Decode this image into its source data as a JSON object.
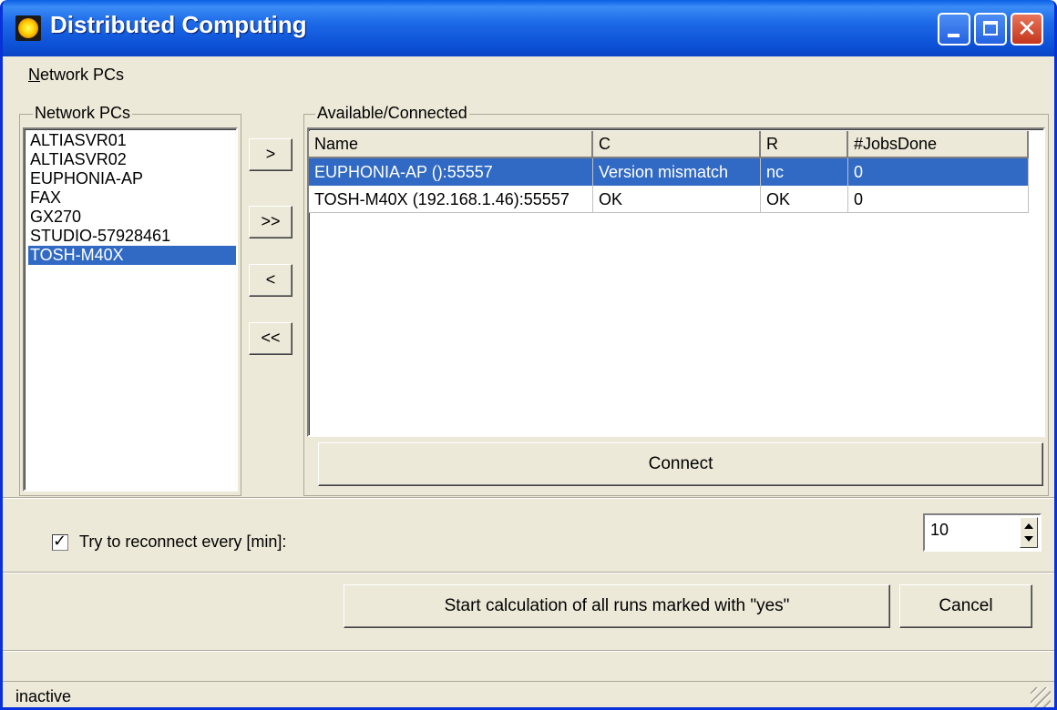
{
  "window": {
    "title": "Distributed Computing",
    "colors": {
      "titlebar": "#0a5fe6",
      "selection": "#316ac5",
      "face": "#ece9d8",
      "close": "#c4361c"
    },
    "controls": {
      "minimize_icon": "minimize-icon",
      "maximize_icon": "maximize-icon",
      "close_glyph": "✕"
    }
  },
  "menu": {
    "items": [
      {
        "first_letter": "N",
        "rest": "etwork PCs"
      }
    ]
  },
  "network_pcs": {
    "label": "Network PCs",
    "items": [
      {
        "name": "ALTIASVR01",
        "selected": false
      },
      {
        "name": "ALTIASVR02",
        "selected": false
      },
      {
        "name": "EUPHONIA-AP",
        "selected": false
      },
      {
        "name": "FAX",
        "selected": false
      },
      {
        "name": "GX270",
        "selected": false
      },
      {
        "name": "STUDIO-57928461",
        "selected": false
      },
      {
        "name": "TOSH-M40X",
        "selected": true
      }
    ]
  },
  "transfer_buttons": {
    "add": ">",
    "add_all": ">>",
    "remove": "<",
    "remove_all": "<<"
  },
  "available": {
    "label": "Available/Connected",
    "columns": [
      "Name",
      "C",
      "R",
      "#JobsDone"
    ],
    "rows": [
      {
        "cells": [
          "EUPHONIA-AP ():55557",
          "Version mismatch",
          "nc",
          "0"
        ],
        "selected": true
      },
      {
        "cells": [
          "TOSH-M40X (192.168.1.46):55557",
          "OK",
          "OK",
          "0"
        ],
        "selected": false
      }
    ],
    "connect_label": "Connect"
  },
  "reconnect": {
    "checked": true,
    "check_glyph": "✓",
    "label": "Try to reconnect every [min]:",
    "value": "10"
  },
  "actions": {
    "start_label": "Start calculation of all runs marked with \"yes\"",
    "cancel_label": "Cancel"
  },
  "status": {
    "text": "inactive"
  }
}
